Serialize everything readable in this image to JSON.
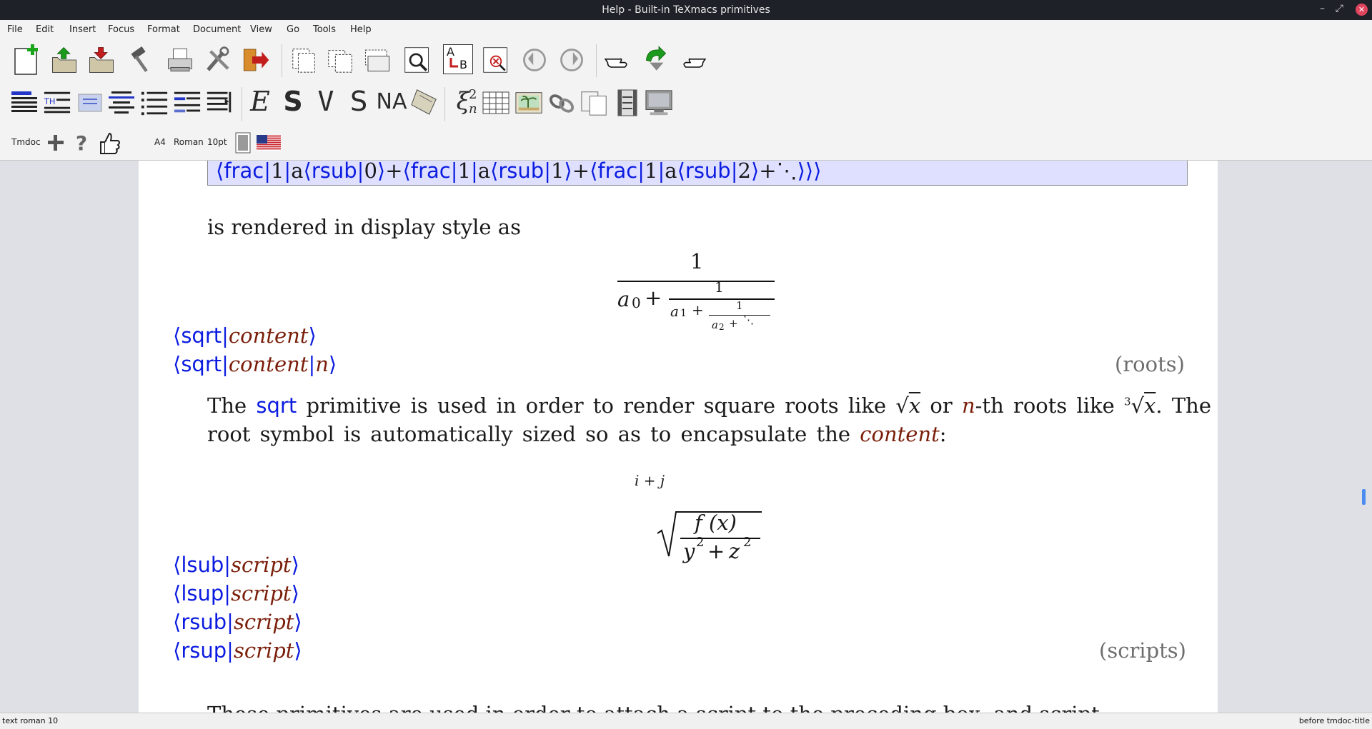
{
  "window": {
    "title": "Help - Built-in TeXmacs primitives",
    "controls": [
      "–",
      "⤢",
      "✕"
    ]
  },
  "menu": [
    "File",
    "Edit",
    "Insert",
    "Focus",
    "Format",
    "Document",
    "View",
    "Go",
    "Tools",
    "Help"
  ],
  "toolbar3": {
    "style": "Tmdoc",
    "paper": "A4",
    "font": "Roman",
    "size": "10pt"
  },
  "toolbar2_text_icons": {
    "emph": "E",
    "strong": "S",
    "verbatim": "V",
    "sans": "S",
    "name": "NA",
    "xi": "ξ",
    "xi_sup": "2",
    "xi_sub": "n"
  },
  "toolbar1_text_icons": {
    "ab_a": "A",
    "ab_b": "B"
  },
  "document": {
    "codeline": {
      "p1": "⟨",
      "frac1": "frac",
      "bar": "|",
      "one": "1",
      "a": "a",
      "rsub": "rsub",
      "zero": "0",
      "two": "2",
      "close": "⟩",
      "plus": "+",
      "dots": "⋱",
      "closeall": "⟩⟩⟩"
    },
    "rendered_text": "is rendered in display style as",
    "fraction": {
      "numerator": "1",
      "a0": "a",
      "sub0": "0",
      "plus": "+",
      "n1": "1",
      "a1": "a",
      "sub1": "1",
      "n2": "1",
      "a2": "a",
      "sub2": "2",
      "dots": "⋱"
    },
    "sqrt_defs": {
      "open": "⟨",
      "name": "sqrt",
      "sep": "|",
      "arg1": "content",
      "arg2": "n",
      "close": "⟩",
      "tag": "(roots)"
    },
    "sqrt_para": {
      "line1_a": "The",
      "line1_sqrt": "sqrt",
      "line1_b": "primitive is used in order to render square roots like",
      "x": "x",
      "or": "or",
      "n": "n",
      "nth": "-th roots like",
      "three": "3",
      "line1_end": ". The",
      "line2_a": "root symbol is automatically sized so as to encapsulate the",
      "line2_content": "content",
      "line2_colon": ":"
    },
    "sqrt_formula": {
      "index": "i + j",
      "numer": "f (x)",
      "denom_y": "y",
      "denom_plus": "+",
      "denom_z": "z",
      "exp": "2"
    },
    "scripts": {
      "items": [
        "lsub",
        "lsup",
        "rsub",
        "rsup"
      ],
      "arg": "script",
      "tag": "(scripts)"
    },
    "cutoff_line": "These primitives are used in order to attach a script to the preceding box, and script"
  },
  "status": {
    "left": "text roman 10",
    "right": "before tmdoc-title"
  },
  "colors": {
    "macro": "#0b1ce0",
    "argument": "#7a1e0a",
    "codebox": "#dfe0ff"
  }
}
